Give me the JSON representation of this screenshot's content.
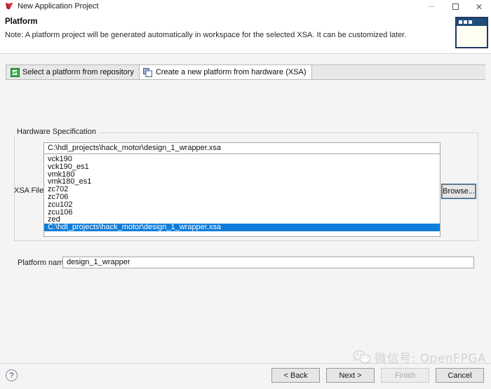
{
  "window": {
    "title": "New Application Project",
    "icon": "xilinx-checkmark-icon",
    "minimize_label": "",
    "maximize_label": "",
    "close_label": "✕"
  },
  "header": {
    "title": "Platform",
    "note": "Note: A platform project will be generated automatically in workspace for the selected XSA. It can be customized later.",
    "banner_icon": "dialog-window-graphic"
  },
  "tabs": [
    {
      "label": "Select a platform from repository",
      "icon": "repository-icon",
      "active": false
    },
    {
      "label": "Create a new platform from hardware (XSA)",
      "icon": "hardware-xsa-icon",
      "active": true
    }
  ],
  "hardware_spec": {
    "group_label": "Hardware Specification",
    "xsa_file_label": "XSA File:",
    "combo_value": "C:\\hdl_projects\\hack_motor\\design_1_wrapper.xsa",
    "browse_label": "Browse...",
    "options": [
      {
        "label": "vck190",
        "selected": false
      },
      {
        "label": "vck190_es1",
        "selected": false
      },
      {
        "label": "vmk180",
        "selected": false
      },
      {
        "label": "vmk180_es1",
        "selected": false
      },
      {
        "label": "zc702",
        "selected": false
      },
      {
        "label": "zc706",
        "selected": false
      },
      {
        "label": "zcu102",
        "selected": false
      },
      {
        "label": "zcu106",
        "selected": false
      },
      {
        "label": "zed",
        "selected": false
      },
      {
        "label": "C:\\hdl_projects\\hack_motor\\design_1_wrapper.xsa",
        "selected": true
      }
    ]
  },
  "platform_name": {
    "label": "Platform name:",
    "value": "design_1_wrapper",
    "placeholder": ""
  },
  "footer": {
    "help_label": "?",
    "buttons": [
      {
        "label": "< Back",
        "disabled": false
      },
      {
        "label": "Next >",
        "disabled": false
      },
      {
        "label": "Finish",
        "disabled": true
      },
      {
        "label": "Cancel",
        "disabled": false
      }
    ]
  },
  "watermark": {
    "text": "微信号: OpenFPGA",
    "logo": "wechat-logo"
  },
  "colors": {
    "selection_blue": "#0f7ddb",
    "banner_navy": "#1f3864",
    "tab_icon_green": "#3fae4e",
    "dialog_bg": "#f4f4f4"
  }
}
